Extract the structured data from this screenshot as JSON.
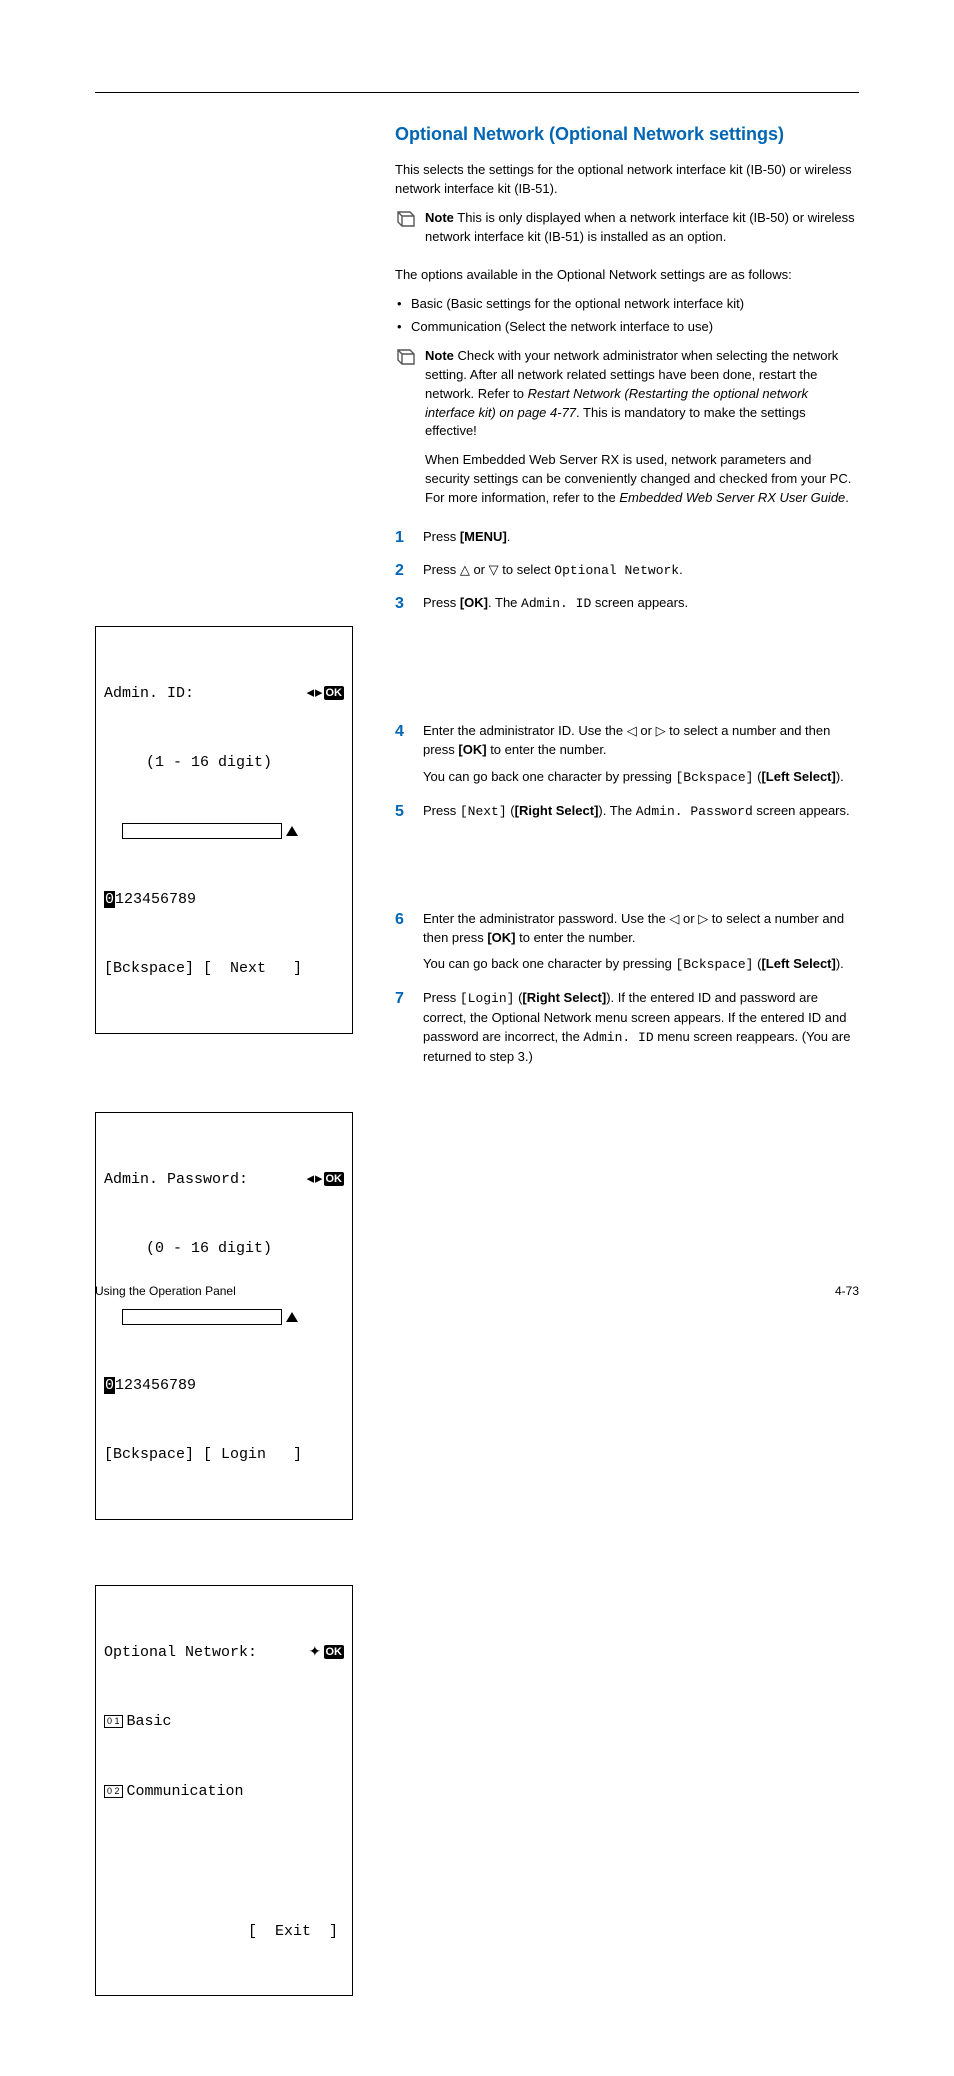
{
  "title": "Optional Network (Optional Network settings)",
  "intro": "This selects the settings for the optional network interface kit (IB-50) or wireless network interface kit (IB-51).",
  "note1_label": "Note",
  "note1_text": "This is only displayed when a network interface kit (IB-50) or wireless network interface kit (IB-51) is installed as an option.",
  "options_intro": "The options available in the Optional Network settings are as follows:",
  "bullet1": "Basic (Basic settings for the optional network interface kit)",
  "bullet2": "Communication (Select the network interface to use)",
  "note2_label": "Note",
  "note2_p1a": "Check with your network administrator when selecting the network setting. After all network related settings have been done, restart the network. Refer to ",
  "note2_p1_italic": "Restart Network (Restarting the optional network interface kit) on page 4-77",
  "note2_p1b": ". This is mandatory to make the settings effective!",
  "note2_p2a": "When Embedded Web Server RX is used, network parameters and security settings can be conveniently changed and checked from your PC. For more information, refer to the ",
  "note2_p2_italic": "Embedded Web Server RX User Guide",
  "note2_p2b": ".",
  "steps": {
    "s1": {
      "num": "1",
      "t1": "Press ",
      "b1": "[MENU]",
      "t2": "."
    },
    "s2": {
      "num": "2",
      "t1": "Press ",
      "t2": " or ",
      "t3": " to select ",
      "m1": "Optional Network",
      "t4": "."
    },
    "s3": {
      "num": "3",
      "t1": "Press ",
      "b1": "[OK]",
      "t2": ". The ",
      "m1": "Admin. ID",
      "t3": " screen  appears."
    },
    "s4": {
      "num": "4",
      "p1a": "Enter the administrator ID. Use the ",
      "p1b": " or ",
      "p1c": " to select a number and then press ",
      "b1": "[OK]",
      "p1d": " to enter the number.",
      "p2a": "You can go back one character by pressing ",
      "m1": "[Bckspace]",
      "p2b": " (",
      "b2": "[Left Select]",
      "p2c": ")."
    },
    "s5": {
      "num": "5",
      "p1a": "Press ",
      "m1": "[Next]",
      "p1b": " (",
      "b1": "[Right Select]",
      "p1c": "). The ",
      "m2": "Admin. Password",
      "p1d": " screen appears."
    },
    "s6": {
      "num": "6",
      "p1a": "Enter the administrator password. Use the ",
      "p1b": " or ",
      "p1c": " to select a number and then press ",
      "b1": "[OK]",
      "p1d": " to enter the number.",
      "p2a": "You can go back one character by pressing ",
      "m1": "[Bckspace]",
      "p2b": " (",
      "b2": "[Left Select]",
      "p2c": ")."
    },
    "s7": {
      "num": "7",
      "p1a": "Press ",
      "m1": "[Login]",
      "p1b": " (",
      "b1": "[Right Select]",
      "p1c": "). If the entered ID and password are correct, the Optional Network menu screen appears. If the entered ID and password are incorrect, the ",
      "m2": "Admin. ID",
      "p1d": " menu screen reappears. (You are returned to step 3.)"
    }
  },
  "lcd1": {
    "title": "Admin. ID:",
    "hint": "(1 - 16 digit)",
    "cursor": "0",
    "rest": "123456789",
    "left": "[Bckspace]",
    "right": "[  Next   ]"
  },
  "lcd2": {
    "title": "Admin. Password:",
    "hint": "(0 - 16 digit)",
    "cursor": "0",
    "rest": "123456789",
    "left": "[Bckspace]",
    "right": "[ Login   ]"
  },
  "lcd3": {
    "title": "Optional Network:",
    "item1_num": "0 1",
    "item1": "Basic",
    "item2_num": "0 2",
    "item2": "Communication",
    "exit": "[  Exit  ]"
  },
  "footer_left": "Using the Operation Panel",
  "footer_right": "4-73",
  "ok_label": "OK"
}
